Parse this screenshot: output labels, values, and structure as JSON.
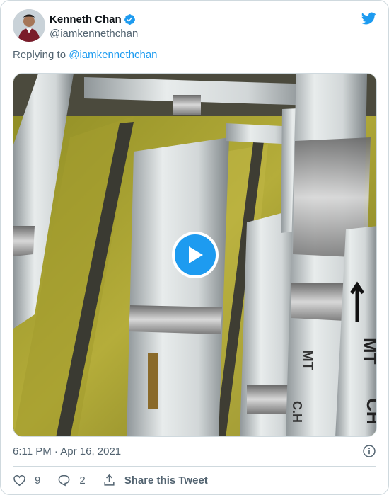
{
  "author": {
    "name": "Kenneth Chan",
    "handle": "@iamkennethchan",
    "verified": true
  },
  "reply": {
    "prefix": "Replying to ",
    "mention": "@iamkennethchan"
  },
  "media": {
    "type": "video"
  },
  "timestamp": "6:11 PM · Apr 16, 2021",
  "actions": {
    "likes": "9",
    "replies": "2",
    "share_label": "Share this Tweet"
  },
  "colors": {
    "accent": "#1d9bf0",
    "secondary_text": "#536471",
    "border": "#cfd9de"
  },
  "icons": [
    "twitter-bird-icon",
    "verified-badge-icon",
    "play-icon",
    "info-icon",
    "heart-icon",
    "reply-bubble-icon",
    "share-icon"
  ]
}
